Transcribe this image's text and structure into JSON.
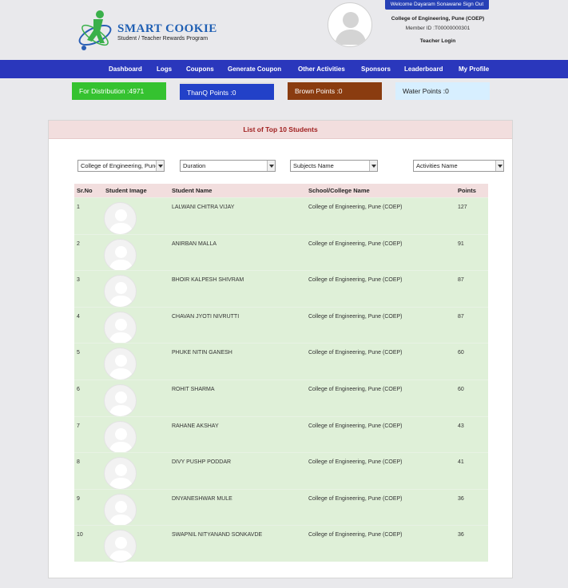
{
  "header": {
    "logo_title": "SMART COOKIE",
    "logo_subtitle": "Student / Teacher Rewards Program",
    "welcome": "Welcome Dayaram Sonawane Sign Out",
    "college": "College of Engineering, Pune (COEP)",
    "member_id": "Member ID :T00000000301",
    "login_type": "Teacher Login"
  },
  "nav": {
    "items": [
      "Dashboard",
      "Logs",
      "Coupons",
      "Generate Coupon",
      "Other Activities",
      "Sponsors",
      "Leaderboard",
      "My Profile"
    ]
  },
  "points": {
    "distribution": "For Distribution :4971",
    "thanq": "ThanQ Points :0",
    "brown": "Brown Points :0",
    "water": "Water Points :0"
  },
  "panel": {
    "title": "List of Top 10 Students",
    "filters": {
      "college": "College of Engineering, Pune",
      "duration": "Duration",
      "subjects": "Subjects Name",
      "activities": "Activities Name"
    },
    "columns": [
      "Sr.No",
      "Student Image",
      "Student Name",
      "School/College Name",
      "Points"
    ],
    "rows": [
      {
        "sr": "1",
        "name": "LALWANI CHITRA VIJAY",
        "school": "College of Engineering, Pune (COEP)",
        "points": "127"
      },
      {
        "sr": "2",
        "name": "ANIRBAN MALLA",
        "school": "College of Engineering, Pune (COEP)",
        "points": "91"
      },
      {
        "sr": "3",
        "name": "BHOIR KALPESH SHIVRAM",
        "school": "College of Engineering, Pune (COEP)",
        "points": "87"
      },
      {
        "sr": "4",
        "name": "CHAVAN JYOTI NIVRUTTI",
        "school": "College of Engineering, Pune (COEP)",
        "points": "87"
      },
      {
        "sr": "5",
        "name": "PHUKE NITIN GANESH",
        "school": "College of Engineering, Pune (COEP)",
        "points": "60"
      },
      {
        "sr": "6",
        "name": "ROHIT SHARMA",
        "school": "College of Engineering, Pune (COEP)",
        "points": "60"
      },
      {
        "sr": "7",
        "name": "RAHANE AKSHAY",
        "school": "College of Engineering, Pune (COEP)",
        "points": "43"
      },
      {
        "sr": "8",
        "name": "DIVY PUSHP PODDAR",
        "school": "College of Engineering, Pune (COEP)",
        "points": "41"
      },
      {
        "sr": "9",
        "name": "DNYANESHWAR MULE",
        "school": "College of Engineering, Pune (COEP)",
        "points": "36"
      },
      {
        "sr": "10",
        "name": "SWAPNIL NITYANAND SONKAVDE",
        "school": "College of Engineering, Pune (COEP)",
        "points": "36"
      }
    ]
  }
}
